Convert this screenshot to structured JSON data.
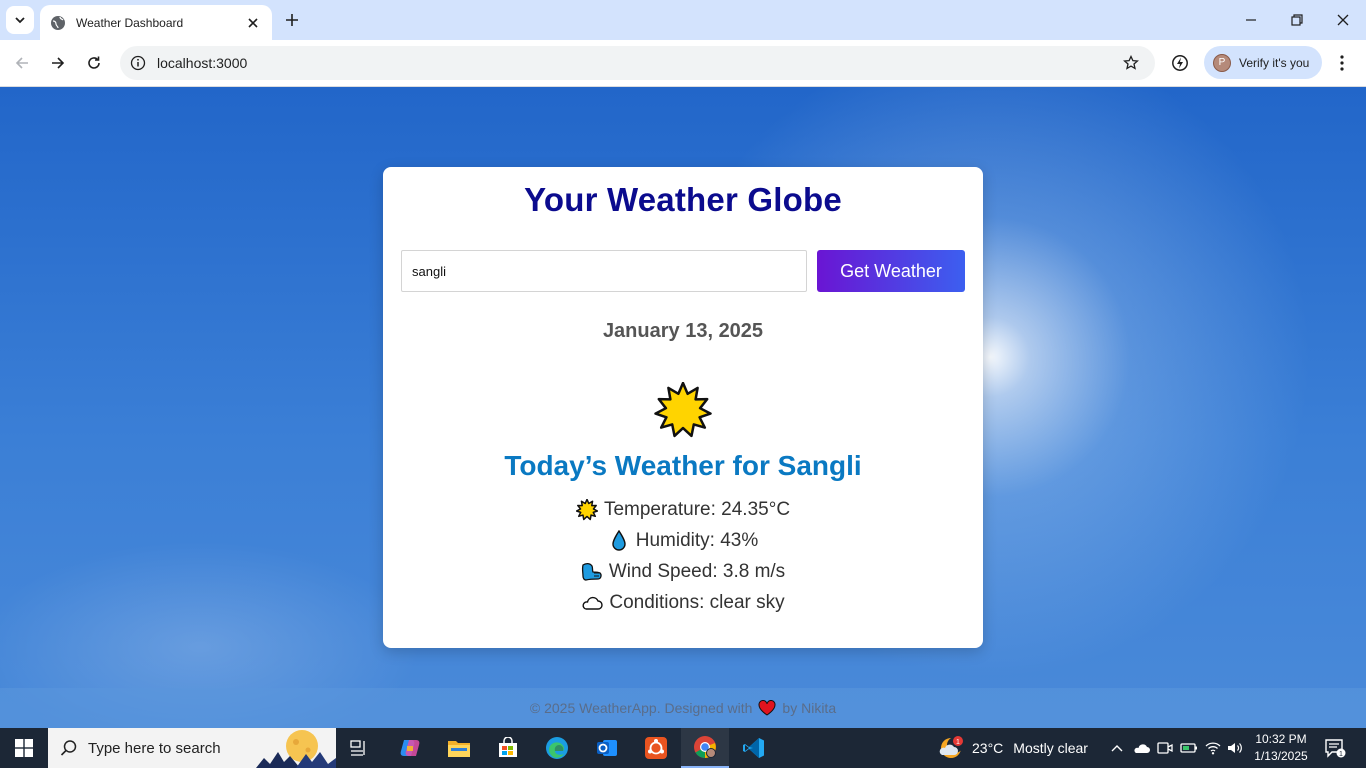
{
  "browser": {
    "tab_title": "Weather Dashboard",
    "url": "localhost:3000",
    "profile_label": "Verify it's you",
    "profile_initial": "P"
  },
  "app": {
    "title": "Your Weather Globe",
    "search_value": "sangli",
    "button_label": "Get Weather",
    "date": "January 13, 2025",
    "heading": "Today’s Weather for Sangli",
    "stats": {
      "temperature": "Temperature: 24.35°C",
      "humidity": "Humidity: 43%",
      "wind": "Wind Speed: 3.8 m/s",
      "conditions": "Conditions: clear sky"
    },
    "footer_left": "© 2025 WeatherApp. Designed with",
    "footer_right": "by Nikita"
  },
  "taskbar": {
    "search_placeholder": "Type here to search",
    "weather_temp": "23°C",
    "weather_desc": "Mostly clear",
    "weather_badge": "1",
    "time": "10:32 PM",
    "date": "1/13/2025",
    "notification_count": "1"
  },
  "colors": {
    "title": "#0b0b8e",
    "heading": "#0a79c2",
    "button_start": "#6a15d3",
    "button_end": "#3c5ff0"
  }
}
